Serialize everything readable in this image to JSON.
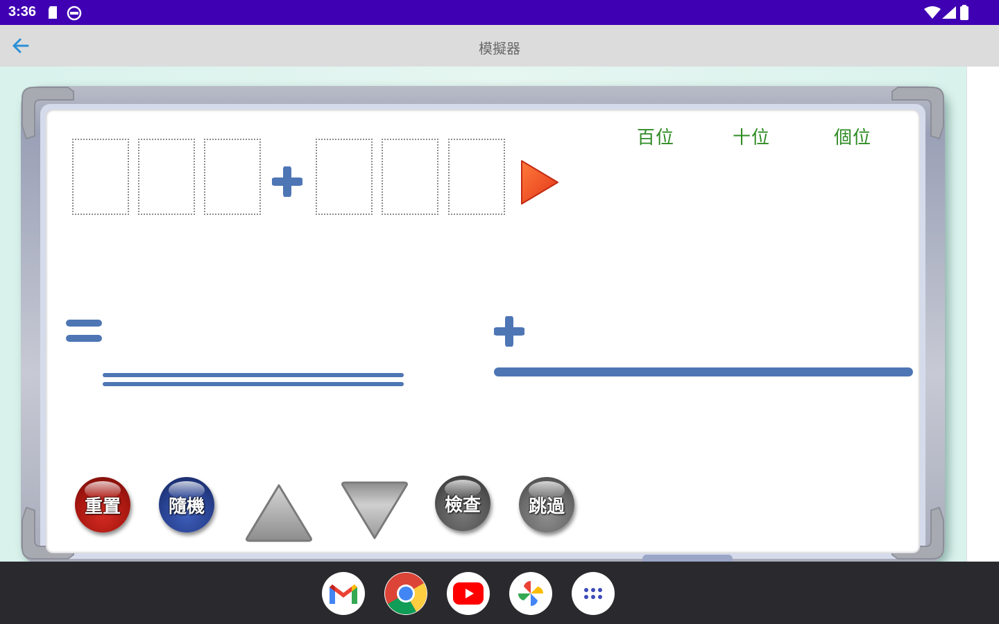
{
  "status_bar": {
    "time": "3:36"
  },
  "app_bar": {
    "title": "模擬器"
  },
  "place_labels": [
    "百位",
    "十位",
    "個位"
  ],
  "buttons": {
    "reset": "重置",
    "random": "隨機",
    "check": "檢查",
    "skip": "跳過"
  },
  "colors": {
    "status_bar": "#3f00b3",
    "accent_blue": "#4e76b5",
    "place_label_green": "#2e8b23",
    "play_orange": "#f04a1c"
  },
  "dock": [
    "gmail-icon",
    "chrome-icon",
    "youtube-icon",
    "photos-icon",
    "app-drawer-icon"
  ]
}
